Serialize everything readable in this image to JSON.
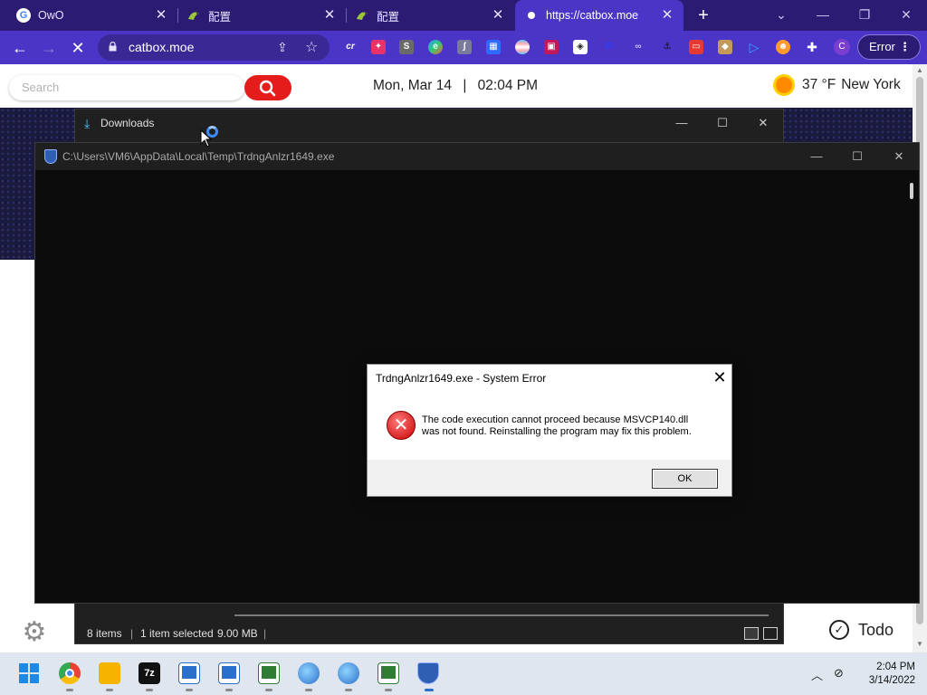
{
  "browser": {
    "tabs": [
      {
        "title": "OwO",
        "icon": "google-icon"
      },
      {
        "title": "配置",
        "icon": "bird-icon"
      },
      {
        "title": "配置",
        "icon": "bird-icon"
      },
      {
        "title": "https://catbox.moe",
        "icon": "loading-dot-icon",
        "active": true
      }
    ],
    "url": "catbox.moe",
    "profile_initial": "C",
    "error_label": "Error",
    "extensions": [
      "cr",
      "pin",
      "s",
      "e",
      "j",
      "grid",
      "pride",
      "img",
      "c",
      "r",
      "link",
      "anchor",
      "card",
      "box",
      "play",
      "face",
      "puzzle"
    ]
  },
  "newtab": {
    "search_placeholder": "Search",
    "date": "Mon, Mar 14",
    "separator": "|",
    "time": "02:04 PM",
    "temperature": "37 °F",
    "location": "New York",
    "todo_label": "Todo"
  },
  "explorer": {
    "title": "Downloads",
    "status_items": "8 items",
    "status_selected": "1 item selected",
    "status_size": "9.00 MB"
  },
  "console": {
    "title": "C:\\Users\\VM6\\AppData\\Local\\Temp\\TrdngAnlzr1649.exe"
  },
  "dialog": {
    "title": "TrdngAnlzr1649.exe - System Error",
    "message_line1": "The code execution cannot proceed because MSVCP140.dll",
    "message_line2": "was not found. Reinstalling the program may fix this problem.",
    "ok_label": "OK"
  },
  "taskbar": {
    "apps": [
      "start",
      "chrome",
      "file-explorer",
      "7zip",
      "app-window-1",
      "app-window-2",
      "app-window-3",
      "globe-app-1",
      "globe-app-2",
      "app-window-4",
      "shield-app"
    ],
    "seven_zip_label": "7z",
    "clock_time": "2:04 PM",
    "clock_date": "3/14/2022"
  },
  "colors": {
    "tabstrip": "#2b1b73",
    "toolbar": "#4a35c7",
    "search_button": "#e51c1c",
    "console_bg": "#0c0c0c",
    "explorer_bg": "#202020"
  }
}
